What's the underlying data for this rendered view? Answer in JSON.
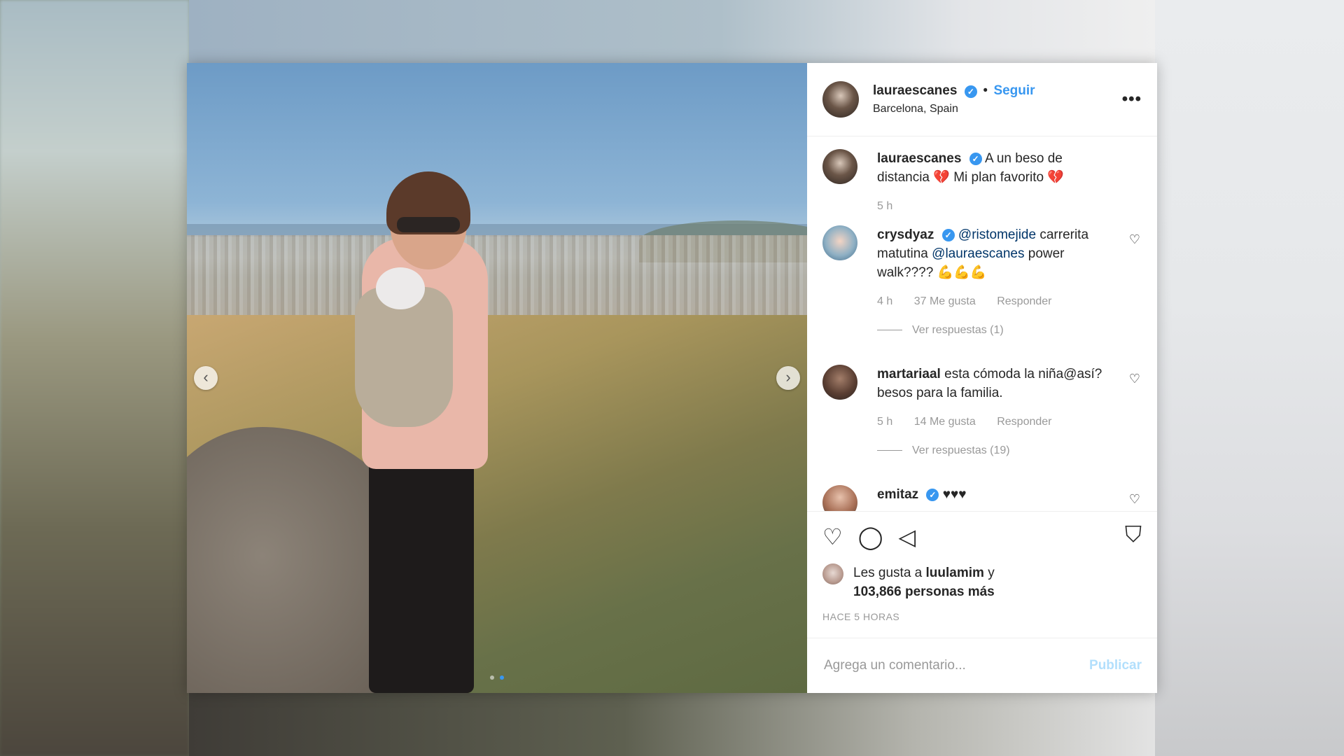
{
  "post": {
    "username": "lauraescanes",
    "follow_separator": "•",
    "follow_label": "Seguir",
    "location": "Barcelona, Spain",
    "more_label": "•••",
    "verified_mark": "✓"
  },
  "caption": {
    "username": "lauraescanes",
    "text": "A un beso de distancia 💔 Mi plan favorito 💔",
    "time": "5 h"
  },
  "comments": [
    {
      "username": "crysdyaz",
      "verified": true,
      "mention1": "@ristomejide",
      "text_mid": "carrerita matutina",
      "mention2": "@lauraescanes",
      "text_end": "power walk???? 💪💪💪",
      "time": "4 h",
      "likes": "37 Me gusta",
      "reply": "Responder",
      "view_replies": "Ver respuestas (1)"
    },
    {
      "username": "martariaal",
      "text": "esta cómoda la niña@así? besos para la familia.",
      "time": "5 h",
      "likes": "14 Me gusta",
      "reply": "Responder",
      "view_replies": "Ver respuestas (19)"
    },
    {
      "username": "emitaz",
      "verified": true,
      "text": "♥♥♥"
    }
  ],
  "actions": {
    "like_icon": "heart-outline",
    "comment_icon": "speech-bubble",
    "share_icon": "paper-plane",
    "save_icon": "bookmark"
  },
  "likes": {
    "prefix": "Les gusta a",
    "user": "luulamim",
    "connector": "y",
    "count_text": "103,866 personas más"
  },
  "posted": "HACE 5 HORAS",
  "comment_box": {
    "placeholder": "Agrega un comentario...",
    "publish_label": "Publicar"
  },
  "colors": {
    "accent": "#3897f0",
    "publish_disabled": "#b2dffc",
    "muted": "#999999",
    "text": "#262626"
  }
}
